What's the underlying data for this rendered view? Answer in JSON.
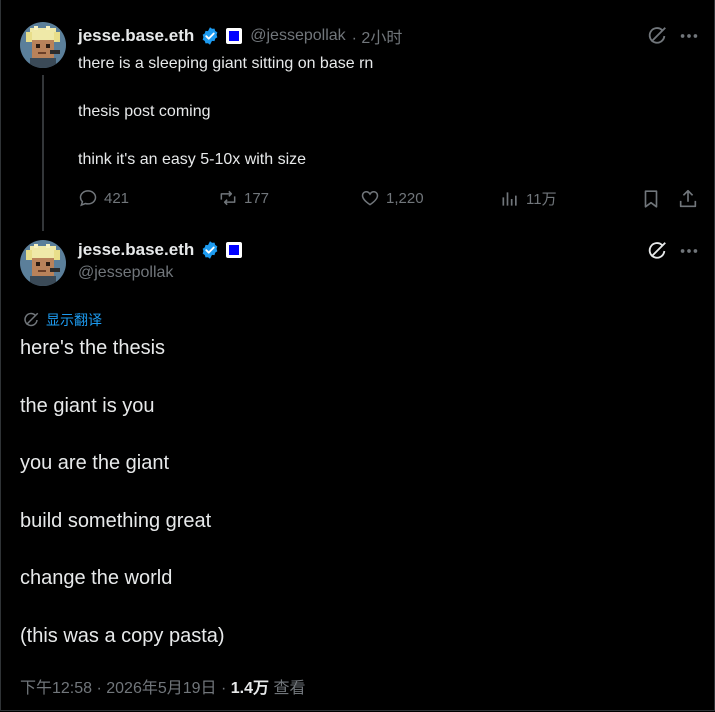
{
  "tweet1": {
    "display_name": "jesse.base.eth",
    "handle": "@jessepollak",
    "time": "· 2小时",
    "lines": [
      "there is a sleeping giant sitting on base rn",
      "thesis post coming",
      "think it's an easy 5-10x with size"
    ],
    "actions": {
      "replies": "421",
      "reposts": "177",
      "likes": "1,220",
      "views": "11万"
    }
  },
  "tweet2": {
    "display_name": "jesse.base.eth",
    "handle": "@jessepollak",
    "translate_label": "显示翻译",
    "lines": [
      "here's the thesis",
      "the giant is you",
      "you are the giant",
      "build something great",
      "change the world",
      "(this was a copy pasta)"
    ],
    "footer": {
      "timestamp": "下午12:58 · 2026年5月19日 · ",
      "views_count": "1.4万",
      "views_label": " 查看"
    }
  },
  "colors": {
    "background": "#000000",
    "text": "#e7e9ea",
    "muted": "#71767b",
    "accent": "#1d9bf0"
  }
}
